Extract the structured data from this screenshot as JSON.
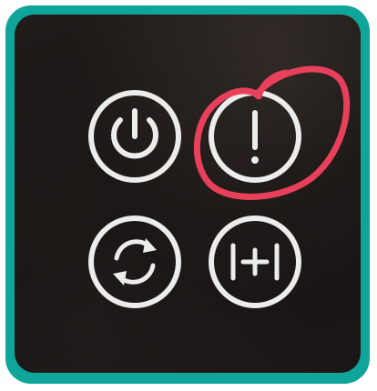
{
  "frame_color": "#10a59a",
  "panel_color": "#161312",
  "symbol_color": "#ececec",
  "annotation_color": "#e8405a",
  "buttons": [
    {
      "id": "power",
      "icon": "power-icon"
    },
    {
      "id": "alert",
      "icon": "exclamation-icon",
      "highlighted": true
    },
    {
      "id": "cycle",
      "icon": "circular-arrows-icon"
    },
    {
      "id": "plus",
      "icon": "bracketed-plus-icon"
    }
  ],
  "annotation": {
    "shape": "hand-drawn-circle",
    "target": "alert"
  }
}
